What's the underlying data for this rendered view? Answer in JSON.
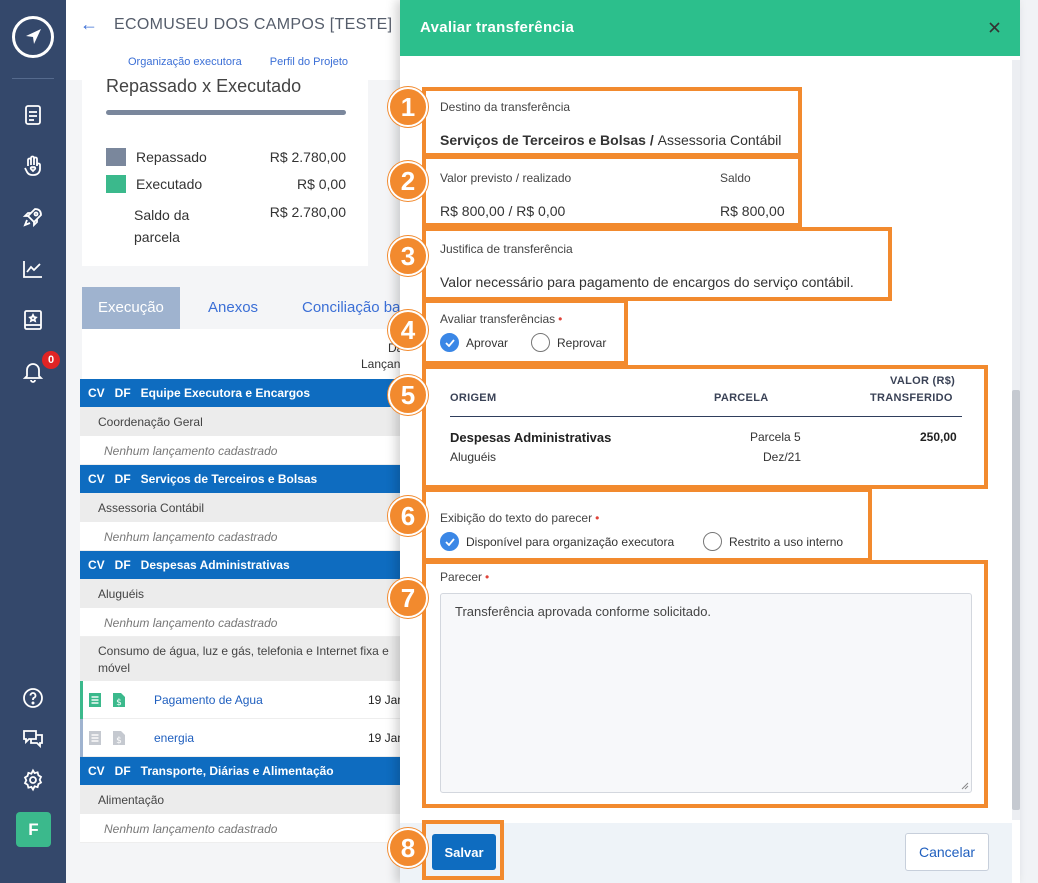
{
  "rail": {
    "icons": [
      "document-icon",
      "hand-heart-icon",
      "rocket-icon",
      "chart-line-icon",
      "book-icon",
      "bell-icon"
    ],
    "notification_count": "0",
    "bottom_icons": [
      "help-icon",
      "chat-icon",
      "gear-icon"
    ],
    "user_initial": "F"
  },
  "page": {
    "title": "ECOMUSEU DOS CAMPOS [TESTE]",
    "tabs": [
      "Organização executora",
      "Perfil do Projeto"
    ],
    "summary": {
      "title": "Repassado x Executado",
      "rows": [
        {
          "label": "Repassado",
          "value": "R$ 2.780,00",
          "color": "#7a879c"
        },
        {
          "label": "Executado",
          "value": "R$ 0,00",
          "color": "#3bb98c"
        },
        {
          "label": "Saldo da parcela",
          "label_line1": "Saldo da",
          "label_line2": "parcela",
          "value": "R$ 2.780,00"
        }
      ]
    },
    "section_tabs": [
      "Execução",
      "Anexos",
      "Conciliação ba"
    ],
    "col_header": {
      "line1": "Da",
      "line2": "Lançan"
    },
    "groups": [
      {
        "cv": "CV",
        "df": "DF",
        "name": "Equipe Executora e Encargos",
        "item": "Coordenação Geral",
        "empty": "Nenhum lançamento cadastrado"
      },
      {
        "cv": "CV",
        "df": "DF",
        "name": "Serviços de Terceiros e Bolsas",
        "item": "Assessoria Contábil",
        "empty": "Nenhum lançamento cadastrado"
      },
      {
        "cv": "CV",
        "df": "DF",
        "name": "Despesas Administrativas",
        "item": "Aluguéis",
        "empty": "Nenhum lançamento cadastrado",
        "item2": "Consumo de água, luz e gás, telefonia e Internet fixa e móvel",
        "entries": [
          {
            "label": "Pagamento de Agua",
            "date": "19 Jan"
          },
          {
            "label": "energia",
            "date": "19 Jan"
          }
        ]
      },
      {
        "cv": "CV",
        "df": "DF",
        "name": "Transporte, Diárias e Alimentação",
        "item": "Alimentação",
        "empty": "Nenhum lançamento cadastrado"
      }
    ]
  },
  "modal": {
    "title": "Avaliar transferência",
    "annotations": [
      "1",
      "2",
      "3",
      "4",
      "5",
      "6",
      "7",
      "8"
    ],
    "accent_color": "#f28a2e",
    "destino": {
      "label": "Destino da transferência",
      "category": "Serviços de Terceiros e Bolsas",
      "separator": " / ",
      "item": "Assessoria Contábil"
    },
    "valor": {
      "label": "Valor previsto / realizado",
      "value": "R$ 800,00 / R$ 0,00",
      "saldo_label": "Saldo",
      "saldo_value": "R$ 800,00"
    },
    "justificativa": {
      "label": "Justifica de transferência",
      "text": "Valor necessário para pagamento de encargos do serviço contábil."
    },
    "avaliar": {
      "label": "Avaliar transferências",
      "options": [
        "Aprovar",
        "Reprovar"
      ],
      "selected": "Aprovar"
    },
    "table": {
      "headers": {
        "origem": "ORIGEM",
        "parcela": "PARCELA",
        "valor_line1": "VALOR (R$)",
        "valor_line2": "TRANSFERIDO"
      },
      "row": {
        "origem": "Despesas Administrativas",
        "origem_sub": "Aluguéis",
        "parcela": "Parcela 5",
        "parcela_sub": "Dez/21",
        "valor": "250,00"
      }
    },
    "exibicao": {
      "label": "Exibição do texto do parecer",
      "options": [
        "Disponível para organização executora",
        "Restrito a uso interno"
      ],
      "selected": "Disponível para organização executora"
    },
    "parecer": {
      "label": "Parecer",
      "value": "Transferência aprovada conforme solicitado."
    },
    "buttons": {
      "save": "Salvar",
      "cancel": "Cancelar"
    }
  }
}
